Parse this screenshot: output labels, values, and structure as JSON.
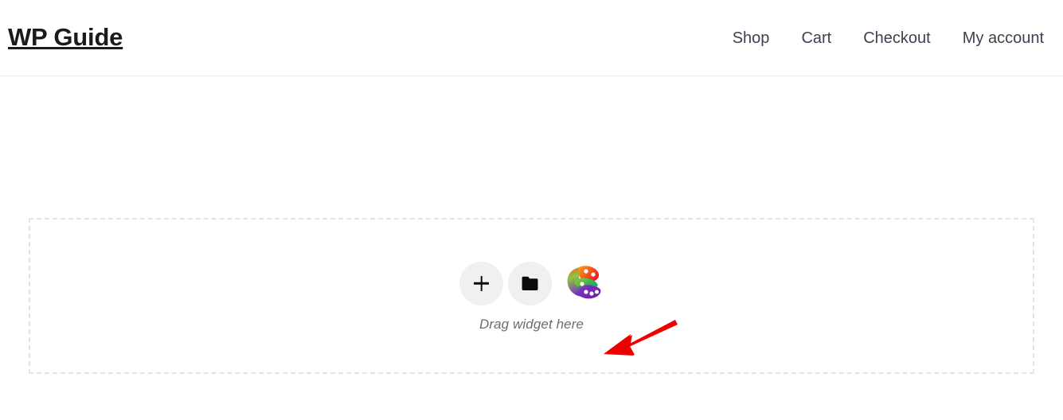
{
  "page": {
    "background_color": "#ffffff"
  },
  "header": {
    "site_title": "WP Guide",
    "title_color": "#1b1b1b",
    "border_color": "#e9eaec",
    "nav": {
      "link_color": "#3a4250",
      "items": [
        {
          "label": "Shop"
        },
        {
          "label": "Cart"
        },
        {
          "label": "Checkout"
        },
        {
          "label": "My account"
        }
      ]
    }
  },
  "editor": {
    "drop_zone": {
      "label": "Drag widget here",
      "label_color": "#6d6d6d",
      "border_color": "#e3e4e6",
      "border_style": "dashed",
      "buttons": [
        {
          "name": "add-new-section",
          "icon": "plus-icon",
          "label": "+",
          "background": "#f0f0f0",
          "icon_color": "#0b0b0b"
        },
        {
          "name": "add-template",
          "icon": "folder-icon",
          "background": "#f0f0f0",
          "icon_color": "#0b0b0b"
        },
        {
          "name": "color-palette",
          "icon": "palette-icon",
          "colors": {
            "orange": "#f47421",
            "red": "#e8402a",
            "green": "#3fae3a",
            "lime": "#8dc63f",
            "purple": "#7b2fbe",
            "violet": "#9b26b6",
            "well": "#ffffff"
          }
        }
      ]
    }
  },
  "annotation": {
    "arrow": {
      "color": "#ee0000",
      "direction": "down-left",
      "points_to": "palette-icon"
    }
  }
}
